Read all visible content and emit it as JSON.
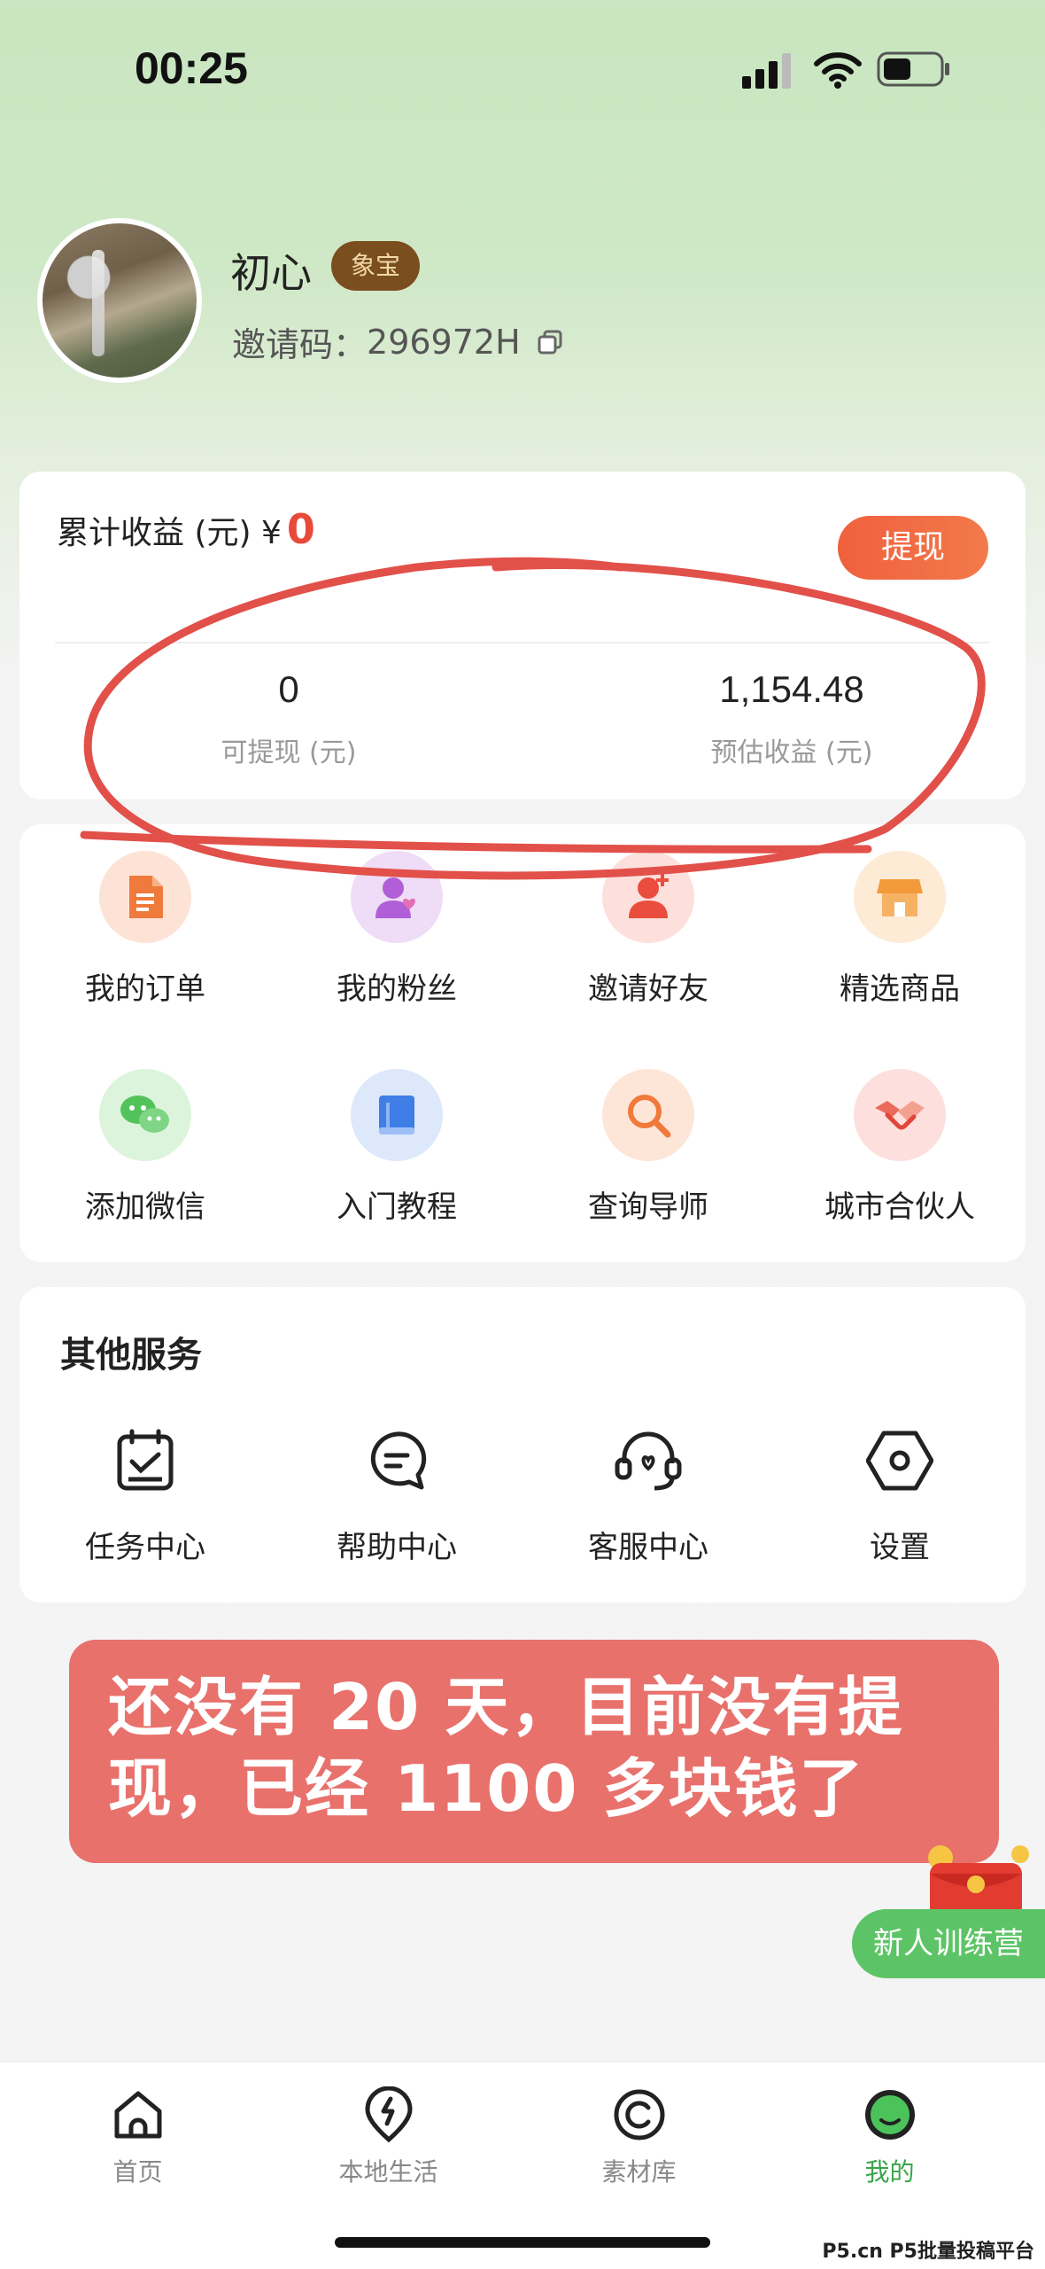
{
  "status_bar": {
    "time": "00:25"
  },
  "profile": {
    "nickname": "初心",
    "level": "象宝",
    "invite_label": "邀请码：",
    "invite_code": "296972H"
  },
  "earnings": {
    "total_label": "累计收益 (元) ¥",
    "total_value": "0",
    "withdraw_label": "提现",
    "withdrawable_value": "0",
    "withdrawable_label": "可提现 (元)",
    "estimated_value": "1,154.48",
    "estimated_label": "预估收益 (元)"
  },
  "menu": {
    "items": [
      {
        "label": "我的订单",
        "icon": "order-icon"
      },
      {
        "label": "我的粉丝",
        "icon": "fans-icon"
      },
      {
        "label": "邀请好友",
        "icon": "invite-friend-icon"
      },
      {
        "label": "精选商品",
        "icon": "shop-icon"
      },
      {
        "label": "添加微信",
        "icon": "wechat-icon"
      },
      {
        "label": "入门教程",
        "icon": "book-icon"
      },
      {
        "label": "查询导师",
        "icon": "search-icon"
      },
      {
        "label": "城市合伙人",
        "icon": "handshake-icon"
      }
    ]
  },
  "services": {
    "title": "其他服务",
    "items": [
      {
        "label": "任务中心",
        "icon": "task-icon"
      },
      {
        "label": "帮助中心",
        "icon": "help-icon"
      },
      {
        "label": "客服中心",
        "icon": "headset-icon"
      },
      {
        "label": "设置",
        "icon": "settings-icon"
      }
    ]
  },
  "annotation": {
    "line1": "还没有 20 天，目前没有提",
    "line2": "现，已经 1100 多块钱了"
  },
  "camp_button": "新人训练营",
  "tabbar": {
    "items": [
      {
        "label": "首页",
        "icon": "home-icon"
      },
      {
        "label": "本地生活",
        "icon": "local-life-icon"
      },
      {
        "label": "素材库",
        "icon": "material-icon"
      },
      {
        "label": "我的",
        "icon": "mine-icon"
      }
    ],
    "active_index": 3
  },
  "watermark": "P5.cn P5批量投稿平台",
  "colors": {
    "accent_red": "#e84a3a",
    "accent_green": "#3aa54a",
    "annotation_bg": "#e8716c",
    "badge_bg": "#7a4e1f"
  }
}
